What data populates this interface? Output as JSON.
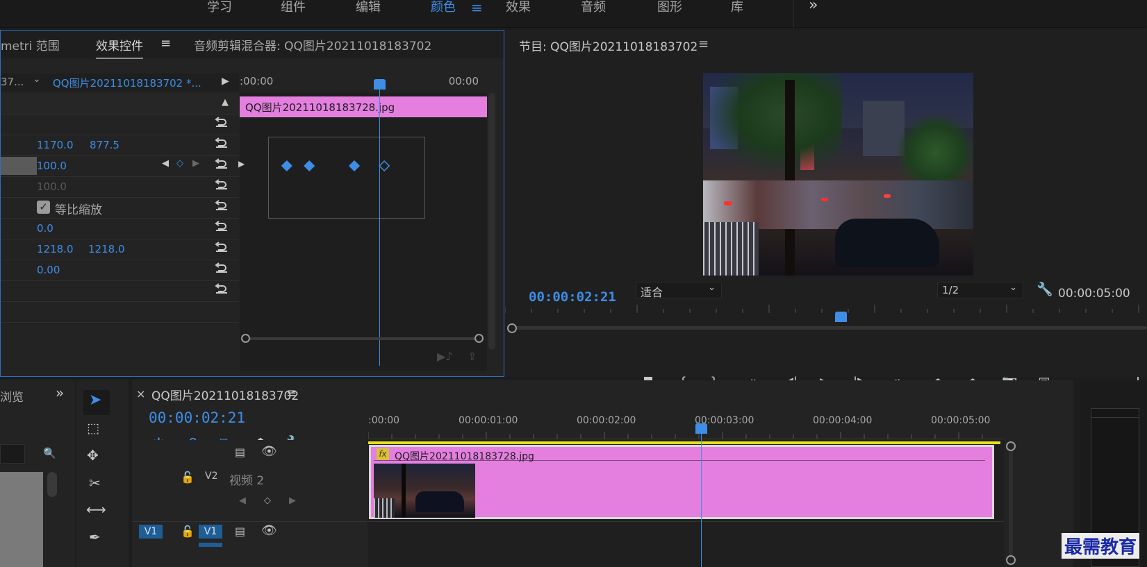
{
  "workspaces": [
    {
      "label": "学习"
    },
    {
      "label": "组件"
    },
    {
      "label": "编辑"
    },
    {
      "label": "颜色"
    },
    {
      "label": "效果"
    },
    {
      "label": "音频"
    },
    {
      "label": "图形"
    },
    {
      "label": "库"
    }
  ],
  "workspace_active": "颜色",
  "overflow_glyph": "»",
  "effect_controls": {
    "tabs": [
      "metri 范围",
      "效果控件",
      "音频剪辑混合器: QQ图片20211018183702"
    ],
    "active_tab": "效果控件",
    "source_prefix": "37...",
    "clip_selector": "QQ图片20211018183702 *...",
    "time_start": ":00:00",
    "time_end": "00:00",
    "clip_bar_label": "QQ图片20211018183728.jpg",
    "position": {
      "x": "1170.0",
      "y": "877.5"
    },
    "scale": "100.0",
    "scale_width": "100.0",
    "uniform_scale_label": "等比缩放",
    "rotation": "0.0",
    "anchor": {
      "x": "1218.0",
      "y": "1218.0"
    },
    "anti_flicker": "0.00",
    "keyframe_values": [
      0.07,
      0.13,
      0.25,
      0.33
    ]
  },
  "program_monitor": {
    "title": "节目: QQ图片20211018183702",
    "current_time": "00:00:02:21",
    "fit_label": "适合",
    "resolution": "1/2",
    "duration": "00:00:05:00",
    "playhead_fraction": 0.57
  },
  "left_panel": {
    "tab_label": "浏览"
  },
  "sequence": {
    "title": "QQ图片20211018183702",
    "current_time": "00:00:02:21",
    "ruler_labels": [
      ":00:00",
      "00:00:01:00",
      "00:00:02:00",
      "00:00:03:00",
      "00:00:04:00",
      "00:00:05:00"
    ],
    "clip_label": "QQ图片20211018183728.jpg",
    "fx_badge": "fx",
    "track_v2": "V2",
    "track_v2_name": "视频 2",
    "track_v1": "V1",
    "playhead_fraction": 0.57
  },
  "watermark": "最需教育",
  "colors": {
    "accent": "#3e8ee8",
    "clip_pink": "#e47fe0",
    "panel": "#232323"
  }
}
